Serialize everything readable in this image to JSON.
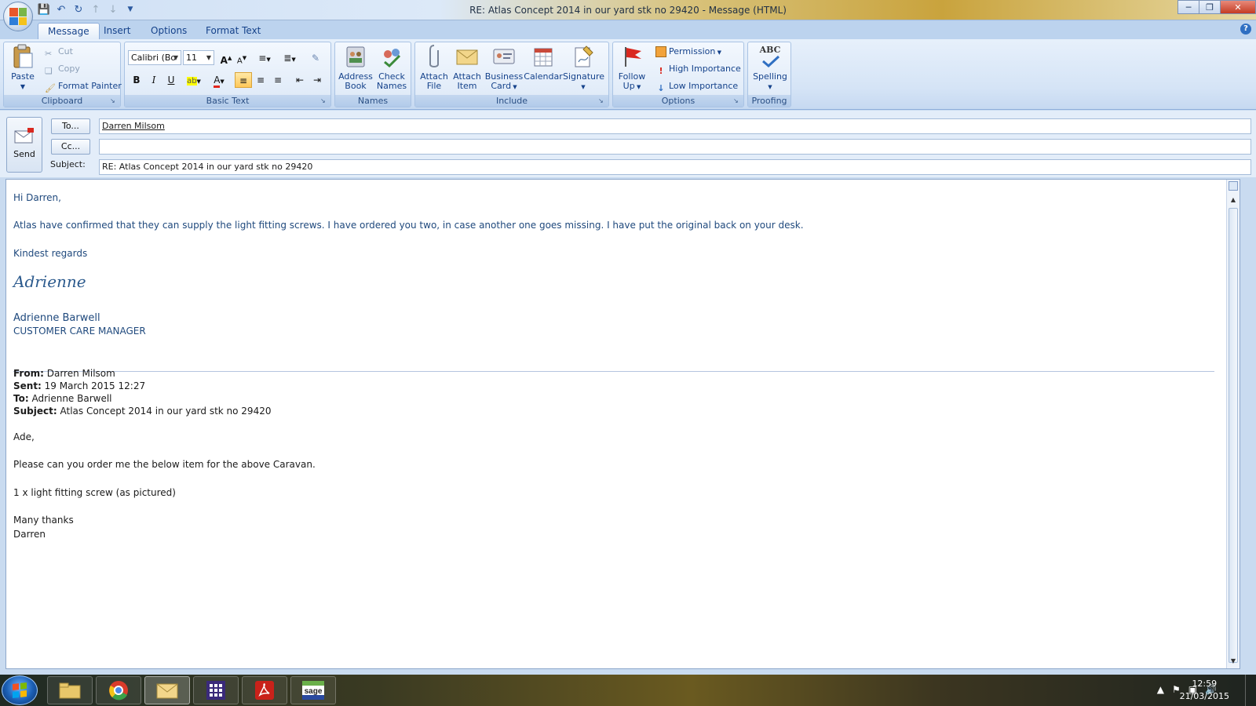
{
  "window": {
    "title": "RE: Atlas Concept 2014 in our yard stk no 29420 - Message (HTML)"
  },
  "tabs": [
    "Message",
    "Insert",
    "Options",
    "Format Text"
  ],
  "ribbon": {
    "clipboard": {
      "label": "Clipboard",
      "paste": "Paste",
      "cut": "Cut",
      "copy": "Copy",
      "format_painter": "Format Painter"
    },
    "basic_text": {
      "label": "Basic Text",
      "font": "Calibri (Bo",
      "size": "11",
      "bold": "B",
      "italic": "I",
      "underline": "U"
    },
    "names": {
      "label": "Names",
      "address_book_1": "Address",
      "address_book_2": "Book",
      "check_names_1": "Check",
      "check_names_2": "Names"
    },
    "include": {
      "label": "Include",
      "attach_file_1": "Attach",
      "attach_file_2": "File",
      "attach_item_1": "Attach",
      "attach_item_2": "Item",
      "business_card_1": "Business",
      "business_card_2": "Card",
      "calendar": "Calendar",
      "signature": "Signature"
    },
    "options": {
      "label": "Options",
      "follow_up_1": "Follow",
      "follow_up_2": "Up",
      "permission": "Permission",
      "high_importance": "High Importance",
      "low_importance": "Low Importance"
    },
    "proofing": {
      "label": "Proofing",
      "spelling": "Spelling",
      "abc": "ABC"
    }
  },
  "header": {
    "send": "Send",
    "to_button": "To...",
    "cc_button": "Cc...",
    "subject_label": "Subject:",
    "to_value": "Darren Milsom",
    "cc_value": "",
    "subject_value": "RE: Atlas Concept 2014 in our yard stk no 29420"
  },
  "body": {
    "greeting": "Hi Darren,",
    "para1": "Atlas have confirmed that they can supply the light fitting screws.  I have ordered you two, in case another one goes missing.  I have put the original back on your desk.",
    "closing": "Kindest regards",
    "signature_script": "Adrienne",
    "sender_name": "Adrienne Barwell",
    "sender_title": "CUSTOMER CARE MANAGER",
    "quoted": {
      "from_label": "From:",
      "from_value": " Darren Milsom",
      "sent_label": "Sent:",
      "sent_value": " 19 March 2015 12:27",
      "to_label": "To:",
      "to_value": " Adrienne Barwell",
      "subject_label": "Subject:",
      "subject_value": " Atlas Concept 2014 in our yard stk no 29420",
      "greeting": "Ade,",
      "line1": "Please can you order me the below item for the above Caravan.",
      "line2": "1 x light fitting screw (as pictured)",
      "closing": "Many thanks",
      "name": "Darren"
    }
  },
  "taskbar": {
    "time": "12:59",
    "date": "21/03/2015"
  }
}
